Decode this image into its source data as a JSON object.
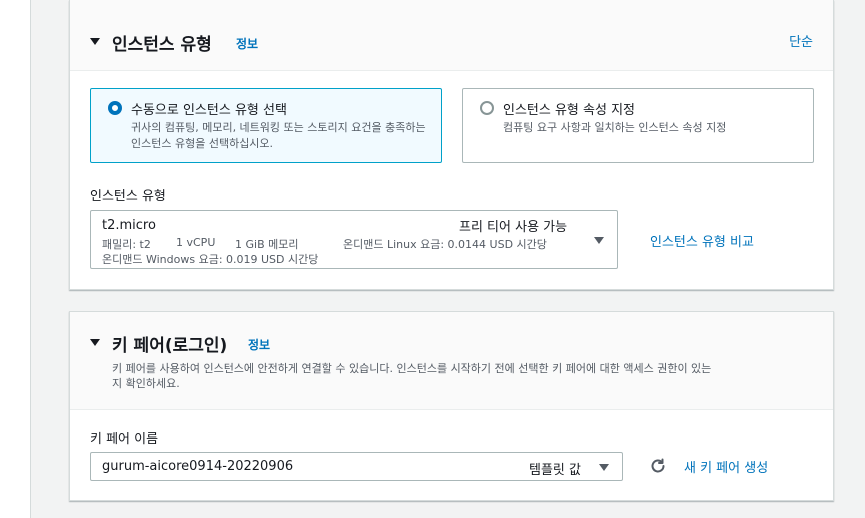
{
  "instance_type_panel": {
    "title": "인스턴스 유형",
    "info_label": "정보",
    "simple_label": "단순",
    "options": [
      {
        "title": "수동으로 인스턴스 유형 선택",
        "description": "귀사의 컴퓨팅, 메모리, 네트워킹 또는 스토리지 요건을 충족하는 인스턴스 유형을 선택하십시오.",
        "selected": true
      },
      {
        "title": "인스턴스 유형 속성 지정",
        "description": "컴퓨팅 요구 사항과 일치하는 인스턴스 속성 지정",
        "selected": false
      }
    ],
    "field_label": "인스턴스 유형",
    "selected_type": {
      "name": "t2.micro",
      "free_tier": "프리 티어 사용 가능",
      "family": "패밀리: t2",
      "vcpu": "1 vCPU",
      "memory": "1 GiB 메모리",
      "linux_price": "온디맨드 Linux 요금: 0.0144 USD 시간당",
      "windows_price": "온디맨드 Windows 요금: 0.019 USD 시간당"
    },
    "compare_link": "인스턴스 유형 비교"
  },
  "key_pair_panel": {
    "title": "키 페어(로그인)",
    "info_label": "정보",
    "description_line1": "키 페어를 사용하여 인스턴스에 안전하게 연결할 수 있습니다. 인스턴스를 시작하기 전에 선택한 키 페어에 대한 액세스 권한이 있는",
    "description_line2": "지 확인하세요.",
    "field_label": "키 페어 이름",
    "selected_key": "gurum-aicore0914-20220906",
    "template_tag": "템플릿 값",
    "create_link": "새 키 페어 생성"
  },
  "colors": {
    "accent": "#0073bb",
    "selected_border": "#00a1c9",
    "selected_bg": "#f1faff"
  }
}
